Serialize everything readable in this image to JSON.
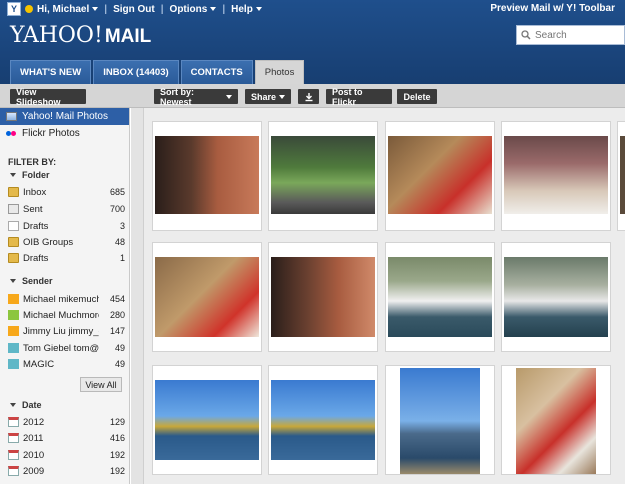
{
  "header": {
    "user_greeting": "Hi, Michael",
    "sign_out": "Sign Out",
    "options": "Options",
    "help": "Help",
    "preview_link": "Preview Mail w/ Y! Toolbar",
    "logo_main": "YAHOO!",
    "logo_sub": "MAIL",
    "search_placeholder": "Search"
  },
  "tabs": [
    {
      "label": "WHAT'S NEW"
    },
    {
      "label": "INBOX (14403)"
    },
    {
      "label": "CONTACTS"
    },
    {
      "label": "Photos"
    }
  ],
  "toolbar": {
    "view_slideshow": "View Slideshow",
    "sort": "Sort by: Newest",
    "share": "Share",
    "post_flickr": "Post to Flickr",
    "delete": "Delete"
  },
  "sidebar": {
    "sources": [
      {
        "label": "Yahoo! Mail Photos"
      },
      {
        "label": "Flickr Photos"
      }
    ],
    "filter_title": "FILTER BY:",
    "folder_head": "Folder",
    "folders": [
      {
        "label": "Inbox",
        "count": "685"
      },
      {
        "label": "Sent",
        "count": "700"
      },
      {
        "label": "Drafts",
        "count": "3"
      },
      {
        "label": "OIB Groups",
        "count": "48"
      },
      {
        "label": "Drafts",
        "count": "1"
      }
    ],
    "sender_head": "Sender",
    "senders": [
      {
        "label": "Michael mikemuch...",
        "count": "454"
      },
      {
        "label": "Michael Muchmore...",
        "count": "280"
      },
      {
        "label": "Jimmy Liu jimmy_c...",
        "count": "147"
      },
      {
        "label": "Tom Giebel tom@t...",
        "count": "49"
      },
      {
        "label": "MAGIC",
        "count": "49"
      }
    ],
    "view_all": "View All",
    "date_head": "Date",
    "dates": [
      {
        "label": "2012",
        "count": "129"
      },
      {
        "label": "2011",
        "count": "416"
      },
      {
        "label": "2010",
        "count": "192"
      },
      {
        "label": "2009",
        "count": "192"
      }
    ]
  },
  "colors": {
    "header_blue": "#1f4f8c",
    "selected_blue": "#2d5fa6",
    "toolbar_button": "#3a3a3a"
  }
}
